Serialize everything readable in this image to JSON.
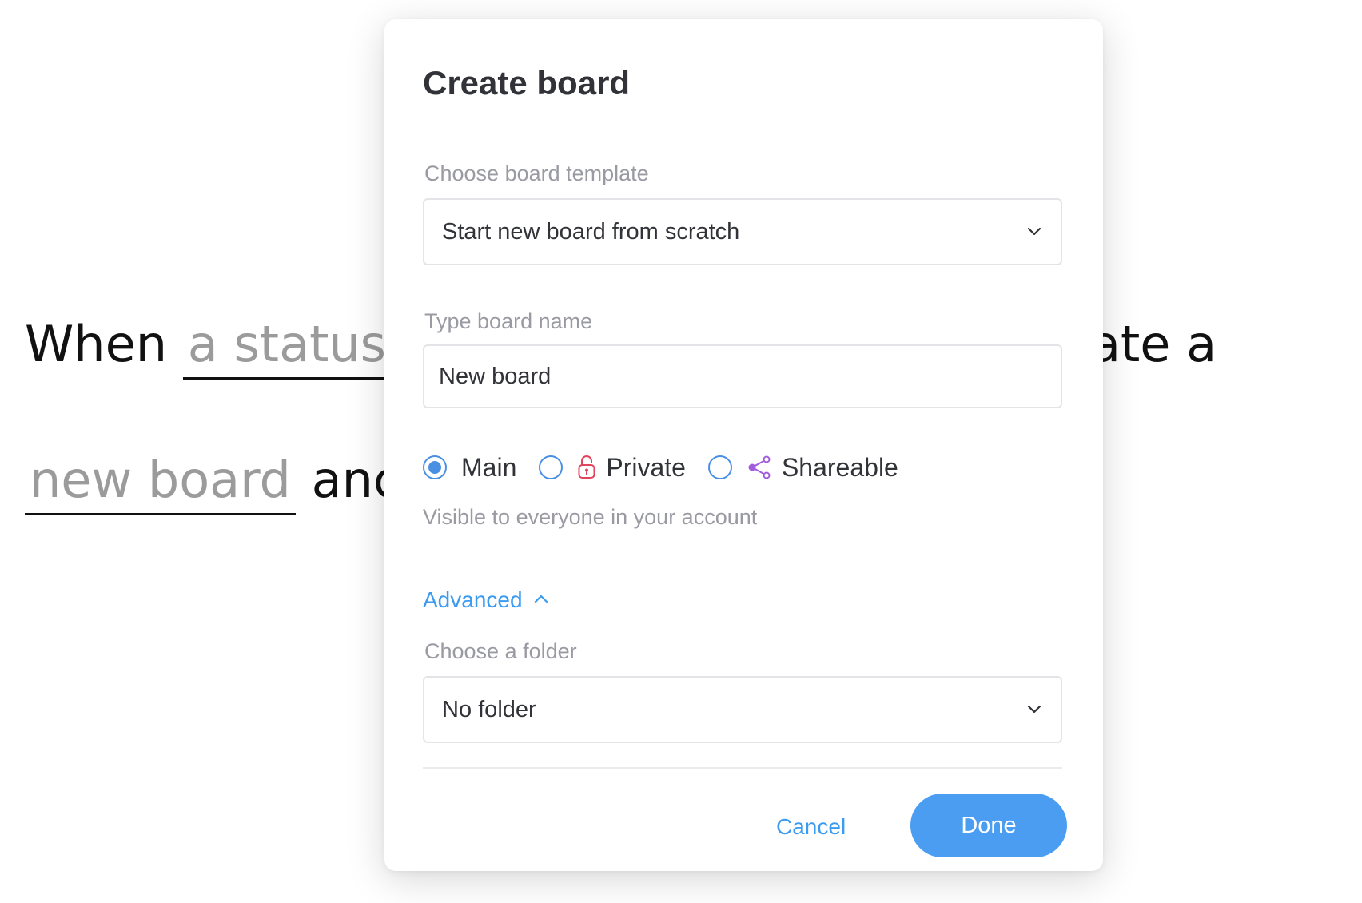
{
  "background": {
    "line1_prefix": "When",
    "line1_blank": "a status",
    "line1_suffix": "ate a",
    "line2_blank": "new board",
    "line2_suffix": "anc"
  },
  "modal": {
    "title": "Create board",
    "template": {
      "label": "Choose board template",
      "value": "Start new board from scratch"
    },
    "name": {
      "label": "Type board name",
      "value": "New board"
    },
    "privacy": {
      "options": [
        {
          "label": "Main",
          "selected": true,
          "icon": null
        },
        {
          "label": "Private",
          "selected": false,
          "icon": "lock-icon"
        },
        {
          "label": "Shareable",
          "selected": false,
          "icon": "share-icon"
        }
      ],
      "hint": "Visible to everyone in your account"
    },
    "advanced": {
      "label": "Advanced",
      "expanded": true
    },
    "folder": {
      "label": "Choose a folder",
      "value": "No folder"
    },
    "cancel_label": "Cancel",
    "done_label": "Done"
  },
  "colors": {
    "accent": "#4a9df0",
    "link": "#3a9bf0",
    "lock": "#e2445c",
    "share": "#a25ddc",
    "text": "#323338",
    "muted": "#9a9aa3"
  }
}
